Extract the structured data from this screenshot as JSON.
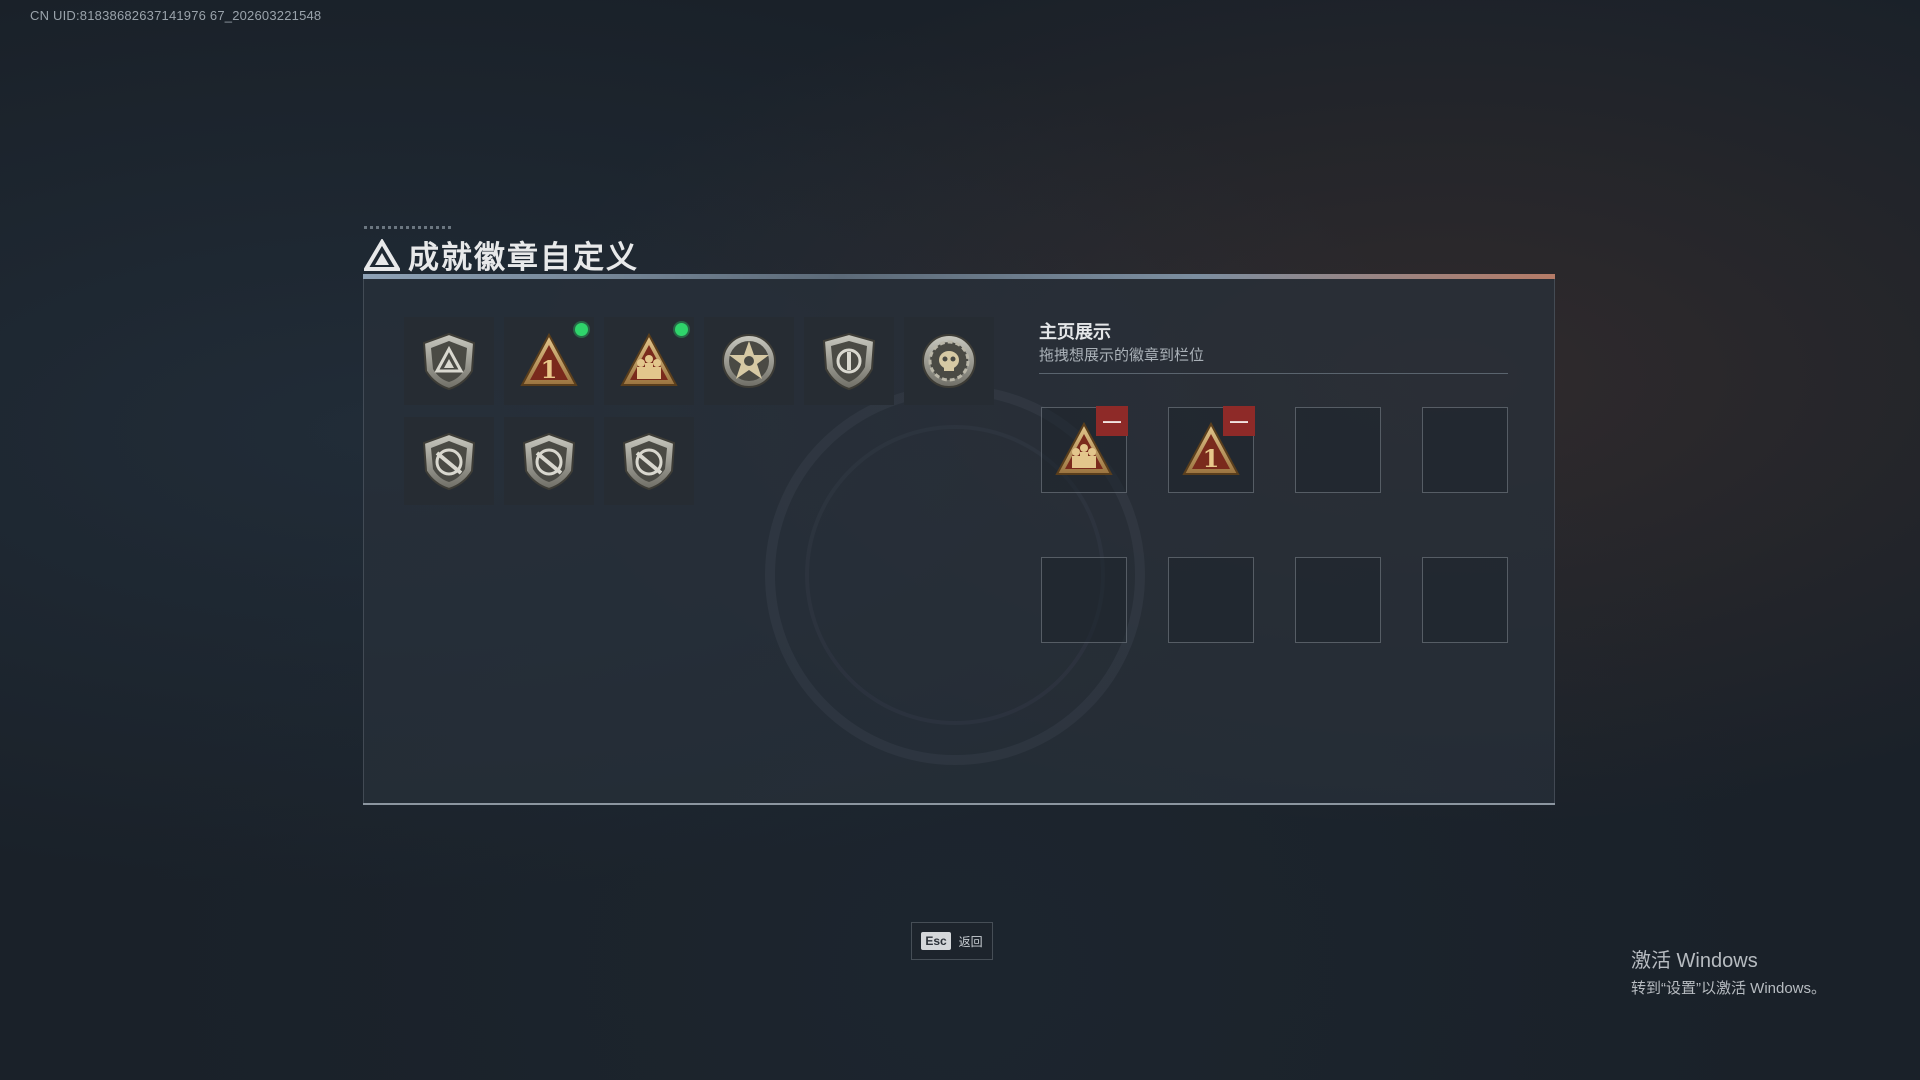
{
  "uid_text": "CN UID:81838682637141976 67_202603221548",
  "title": "成就徽章自定义",
  "badges": [
    {
      "icon": "triangle-shield-badge-icon",
      "new": false
    },
    {
      "icon": "number-one-triangle-badge-icon",
      "new": true
    },
    {
      "icon": "soldiers-triangle-badge-icon",
      "new": true
    },
    {
      "icon": "star-medal-badge-icon",
      "new": false
    },
    {
      "icon": "shield-emblem-badge-icon",
      "new": false
    },
    {
      "icon": "gear-skull-badge-icon",
      "new": false
    },
    {
      "icon": "crossed-rifle-shield-badge-icon",
      "new": false
    },
    {
      "icon": "crossed-rifle-shield-badge-icon",
      "new": false
    },
    {
      "icon": "crossed-rifle-shield-badge-icon",
      "new": false
    }
  ],
  "showcase": {
    "title": "主页展示",
    "subtitle": "拖拽想展示的徽章到栏位",
    "slots": [
      {
        "icon": "soldiers-triangle-badge-icon",
        "filled": true
      },
      {
        "icon": "number-one-triangle-badge-icon",
        "filled": true
      },
      {
        "filled": false
      },
      {
        "filled": false
      },
      {
        "filled": false
      },
      {
        "filled": false
      },
      {
        "filled": false
      },
      {
        "filled": false
      }
    ],
    "remove_label": "—"
  },
  "footer": {
    "esc_key": "Esc",
    "esc_label": "返回"
  },
  "windows_activation": {
    "title": "激活 Windows",
    "subtitle": "转到“设置”以激活 Windows。"
  },
  "colors": {
    "badge_gold": "#c8a56a",
    "new_indicator": "#2fd46b",
    "remove_red": "#8e2a28"
  }
}
